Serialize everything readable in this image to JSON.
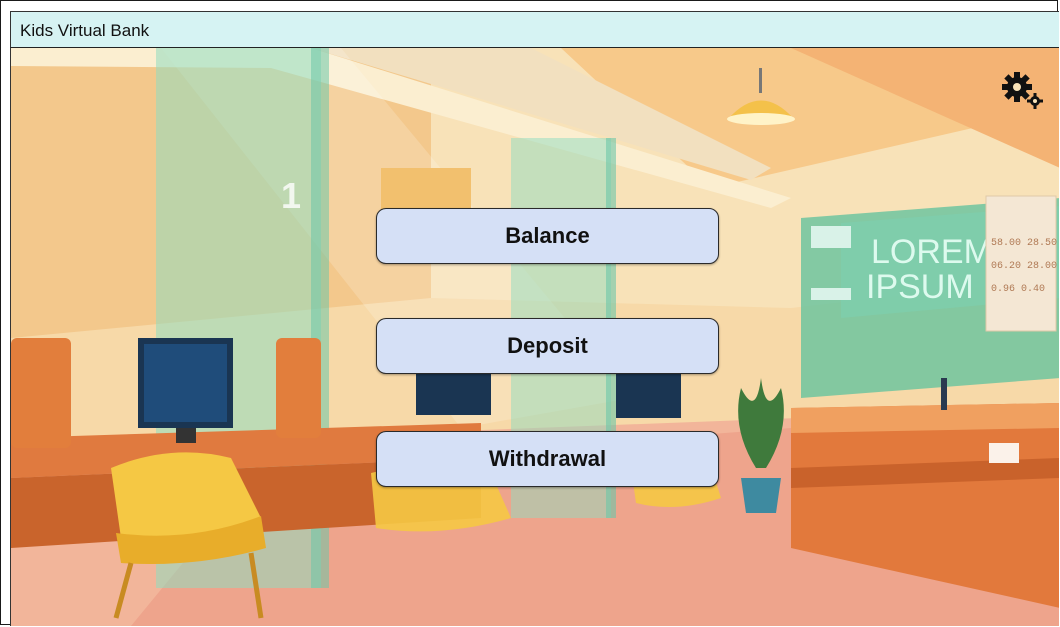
{
  "window": {
    "title": "Kids Virtual Bank"
  },
  "menu": {
    "balance_label": "Balance",
    "deposit_label": "Deposit",
    "withdrawal_label": "Withdrawal"
  },
  "scene": {
    "sign_text_line1": "LOREM",
    "sign_text_line2": "IPSUM",
    "counter_number": "1",
    "rate_board": [
      [
        "58.00",
        "28.50"
      ],
      [
        "06.20",
        "28.00"
      ],
      [
        "0.96",
        "0.40"
      ]
    ]
  },
  "icons": {
    "settings": "gears-icon"
  },
  "colors": {
    "titlebar": "#d6f3f3",
    "button_fill": "#d5e0f6",
    "button_text": "#111111"
  }
}
